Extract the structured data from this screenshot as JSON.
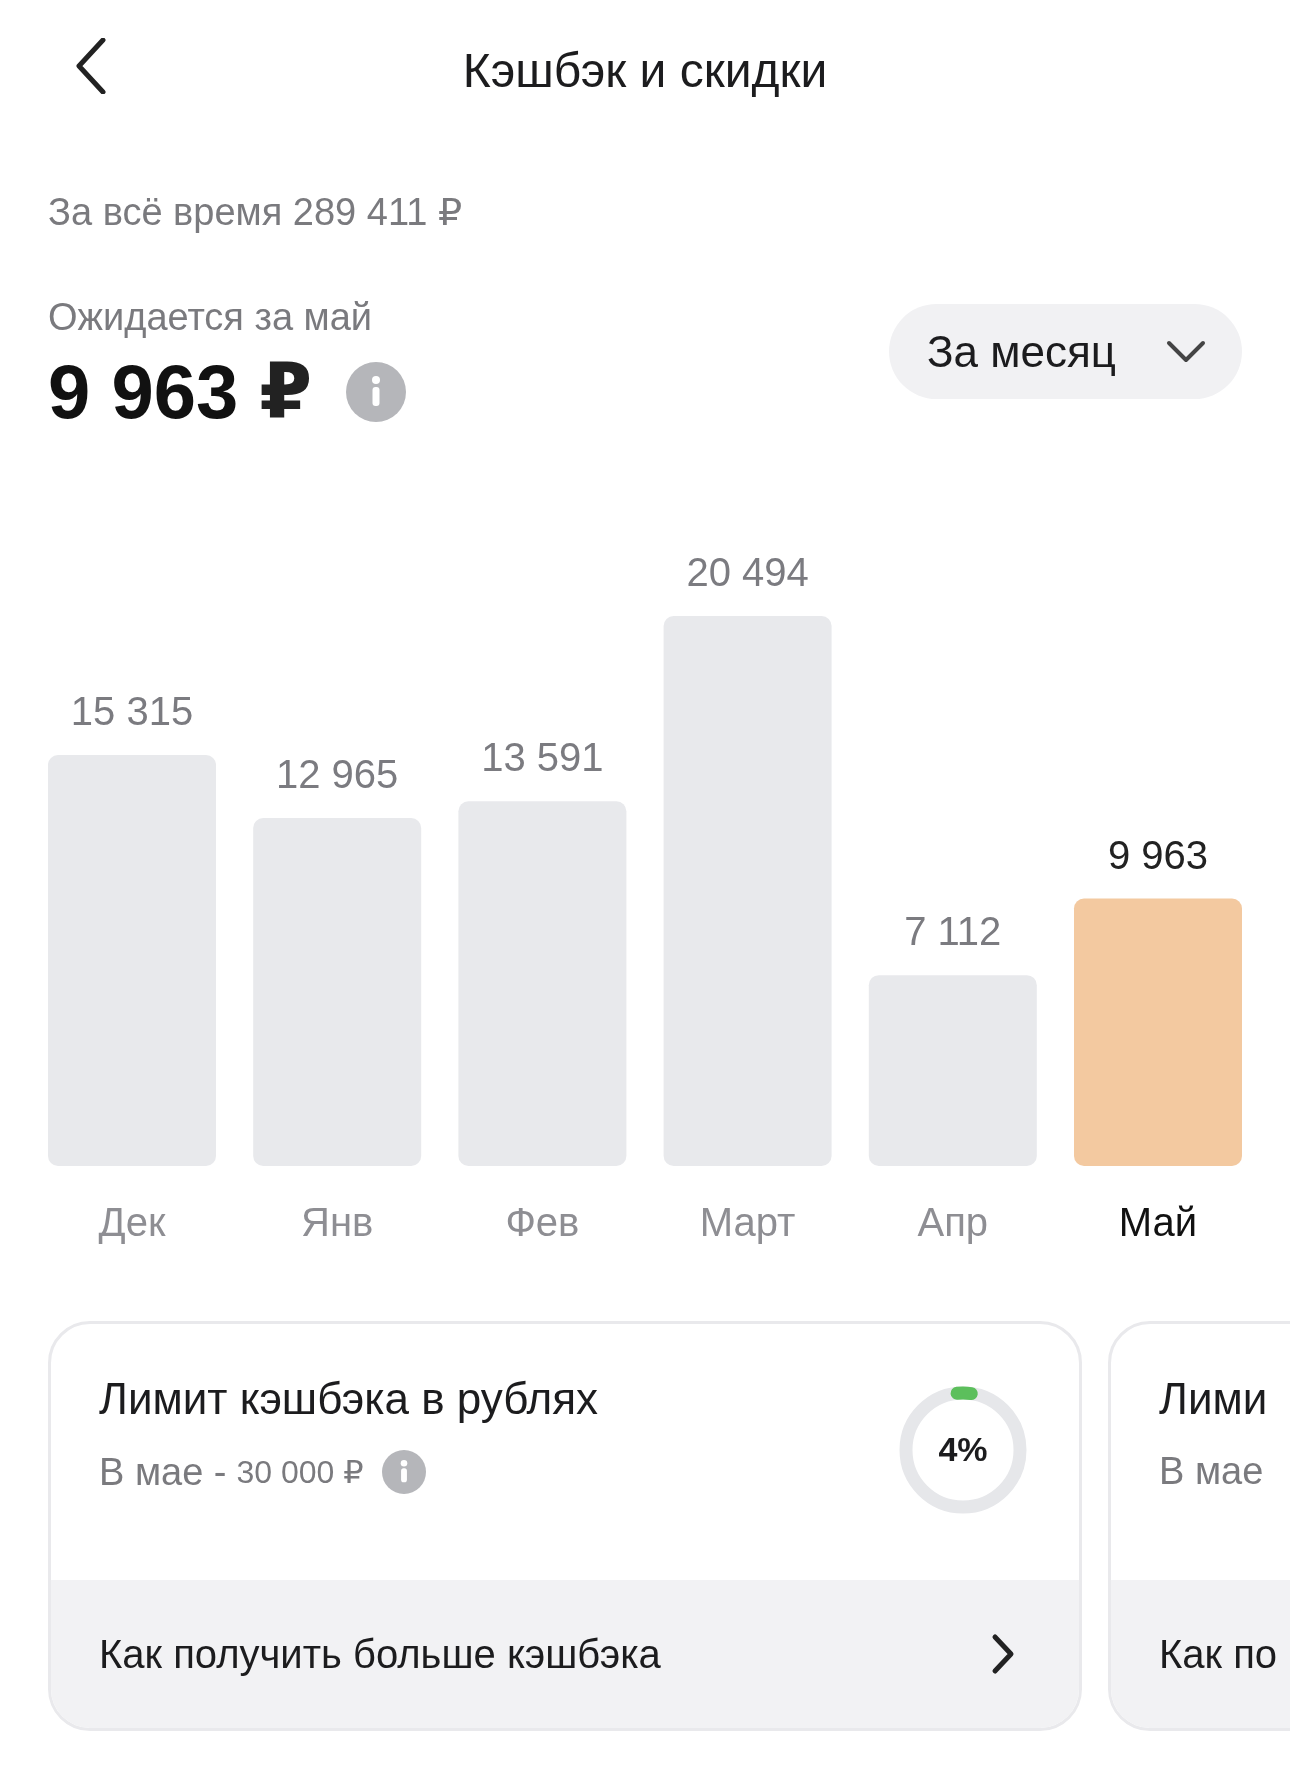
{
  "header": {
    "title": "Кэшбэк и скидки"
  },
  "total": {
    "text": "За всё время 289 411 ₽"
  },
  "expected": {
    "label": "Ожидается за май",
    "amount": "9 963",
    "currency": "₽"
  },
  "period_dropdown": {
    "value": "За месяц"
  },
  "chart_data": {
    "type": "bar",
    "categories": [
      "Дек",
      "Янв",
      "Фев",
      "Март",
      "Апр",
      "Май"
    ],
    "stacked": true,
    "data_labels": true,
    "value_labels": [
      "15 315",
      "12 965",
      "13 591",
      "20 494",
      "7 112",
      "9 963"
    ],
    "series": [
      {
        "color": "#e8e9ec",
        "values": [
          15315,
          12965,
          13591,
          20494,
          7112,
          null
        ]
      },
      {
        "color": "#f3c9a0",
        "values": [
          null,
          null,
          null,
          null,
          null,
          9963
        ]
      }
    ]
  },
  "cards": [
    {
      "title": "Лимит кэшбэка в рублях",
      "subtitle": "В мае -",
      "limit": "30 000 ₽",
      "progress": {
        "level": 0.04,
        "text": "4%"
      },
      "link": "Как получить больше кэшбэка"
    },
    {
      "title": "Лими",
      "subtitle": "В мае",
      "link": "Как по"
    }
  ]
}
